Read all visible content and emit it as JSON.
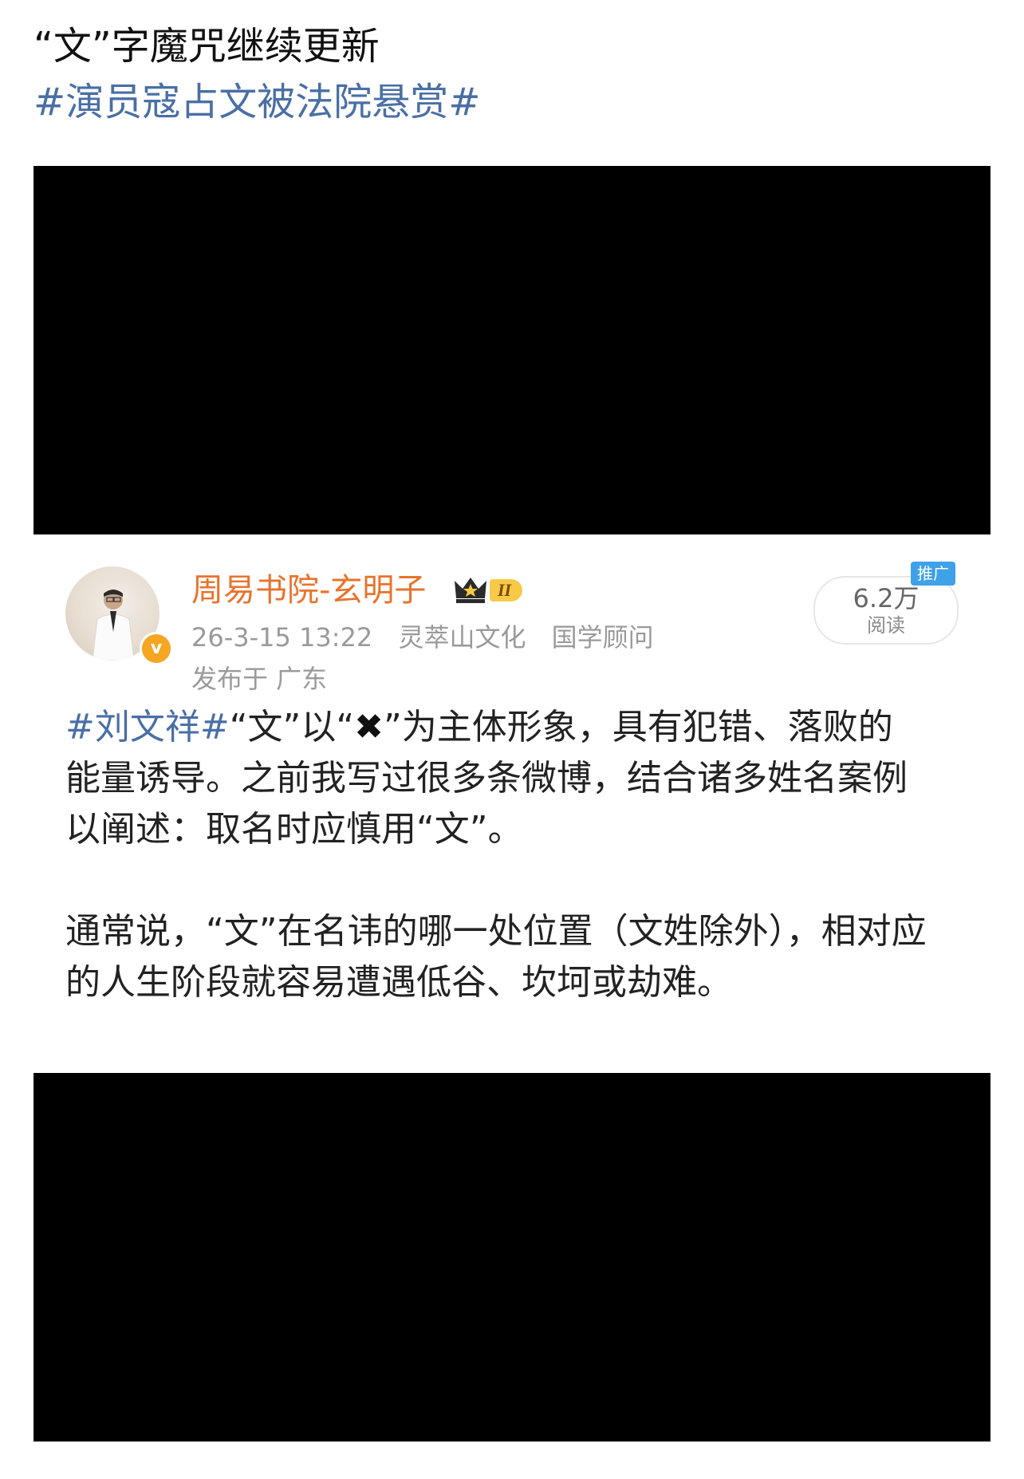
{
  "header": {
    "title": "“文”字魔咒继续更新",
    "topic": "#演员寇占文被法院悬赏#"
  },
  "post": {
    "user_name": "周易书院-玄明子",
    "level": "II",
    "timestamp": "26-3-15 13:22",
    "source": "灵萃山文化",
    "role": "国学顾问",
    "location": "发布于 广东",
    "reads_count": "6.2万",
    "reads_label": "阅读",
    "promo_tag": "推广",
    "verified_mark": "v",
    "body": {
      "hashtag": "#刘文祥#",
      "p1_a": "“文”以“",
      "x_mark": "✖",
      "p1_b": "”为主体形象，具有犯错、落败的",
      "p1_line2": "能量诱导。之前我写过很多条微博，结合诸多姓名案例",
      "p1_line3": "以阐述：取名时应慎用“文”。",
      "p2_line1": "通常说，“文”在名讳的哪一处位置（文姓除外），相对应",
      "p2_line2": "的人生阶段就容易遭遇低谷、坎坷或劫难。"
    }
  },
  "colors": {
    "topic_link": "#4a6fa5",
    "user_name": "#e8732c",
    "meta": "#9a9a9a",
    "verified_badge": "#f5a623",
    "promo_tag": "#3fa1e8"
  }
}
